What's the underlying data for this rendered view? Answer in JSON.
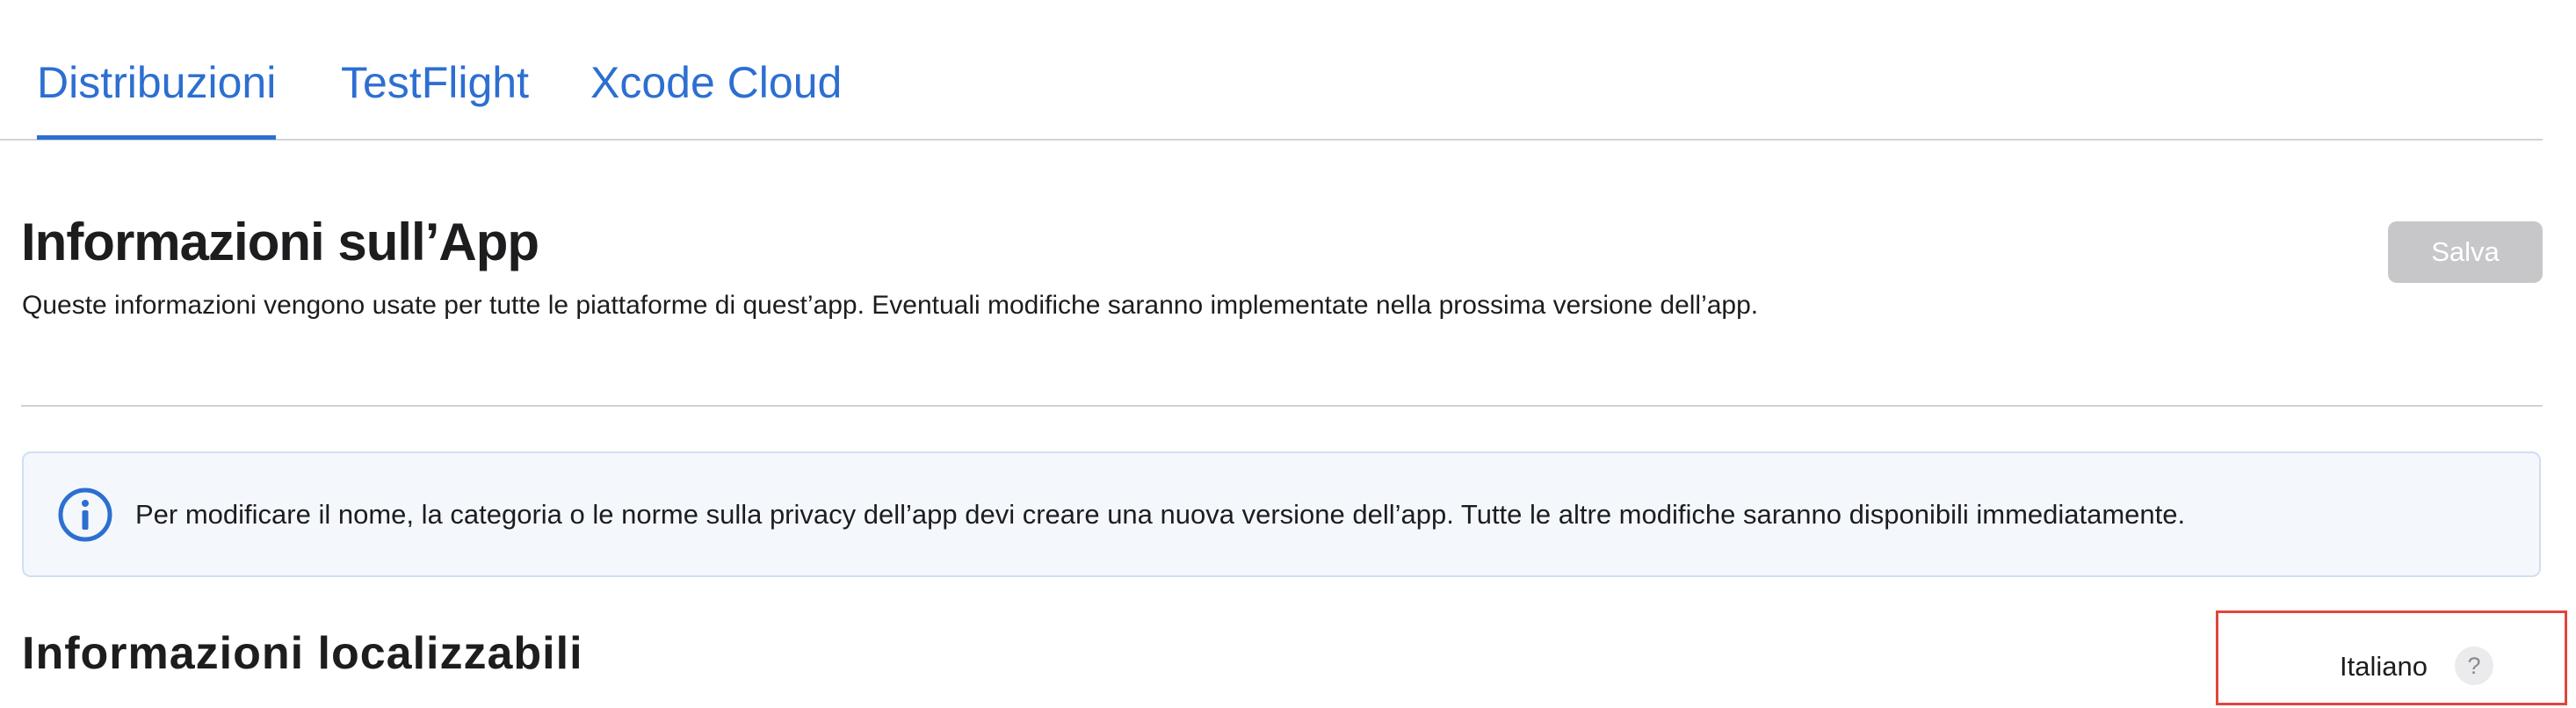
{
  "tabs": [
    {
      "label": "Distribuzioni",
      "active": true
    },
    {
      "label": "TestFlight",
      "active": false
    },
    {
      "label": "Xcode Cloud",
      "active": false
    }
  ],
  "header": {
    "title": "Informazioni sull’App",
    "subtitle": "Queste informazioni vengono usate per tutte le piattaforme di quest’app. Eventuali modifiche saranno implementate nella prossima versione dell’app.",
    "save_label": "Salva"
  },
  "banner": {
    "icon": "info-icon",
    "text": "Per modificare il nome, la categoria o le norme sulla privacy dell’app devi creare una nuova versione dell’app. Tutte le altre modifiche saranno disponibili immediatamente."
  },
  "section": {
    "title": "Informazioni localizzabili",
    "language": "Italiano",
    "help_symbol": "?"
  },
  "colors": {
    "accent": "#2d6fd1",
    "save_disabled": "#c7c7c9",
    "banner_bg": "#f4f8fd",
    "highlight_border": "#e0463a"
  }
}
